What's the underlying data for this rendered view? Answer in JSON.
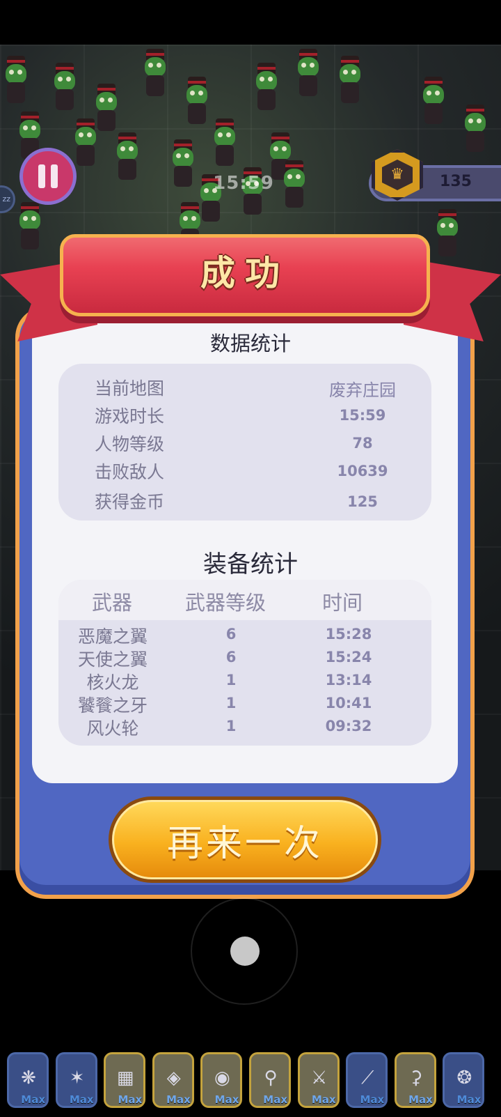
{
  "hud": {
    "timer": "15:59",
    "coins": "135",
    "side_chip": "zz"
  },
  "result": {
    "title": "成功",
    "data_section_title": "数据统计",
    "stats": [
      {
        "label": "当前地图",
        "value": "废弃庄园"
      },
      {
        "label": "游戏时长",
        "value": "15:59"
      },
      {
        "label": "人物等级",
        "value": "78"
      },
      {
        "label": "击败敌人",
        "value": "10639"
      },
      {
        "label": "获得金币",
        "value": "125"
      }
    ],
    "equip_section_title": "装备统计",
    "equip_headers": {
      "weapon": "武器",
      "level": "武器等级",
      "time": "时间"
    },
    "equipment": [
      {
        "name": "恶魔之翼",
        "level": "6",
        "time": "15:28"
      },
      {
        "name": "天使之翼",
        "level": "6",
        "time": "15:24"
      },
      {
        "name": "核火龙",
        "level": "1",
        "time": "13:14"
      },
      {
        "name": "饕餮之牙",
        "level": "1",
        "time": "10:41"
      },
      {
        "name": "风火轮",
        "level": "1",
        "time": "09:32"
      }
    ],
    "retry_label": "再来一次"
  },
  "weapon_bar": {
    "max_label": "Max",
    "slots": [
      {
        "icon": "demon-wings-icon"
      },
      {
        "icon": "angel-wings-icon"
      },
      {
        "icon": "stone-block-icon"
      },
      {
        "icon": "fish-icon"
      },
      {
        "icon": "wheel-icon"
      },
      {
        "icon": "staff-icon"
      },
      {
        "icon": "sword-icon"
      },
      {
        "icon": "spear-icon"
      },
      {
        "icon": "hook-staff-icon"
      },
      {
        "icon": "dragon-icon"
      }
    ]
  },
  "colors": {
    "ribbon": "#e84152",
    "modal_frame": "#5067c2",
    "modal_border": "#f2a14a",
    "button": "#f9b11f",
    "stat_value": "#8885ab"
  }
}
